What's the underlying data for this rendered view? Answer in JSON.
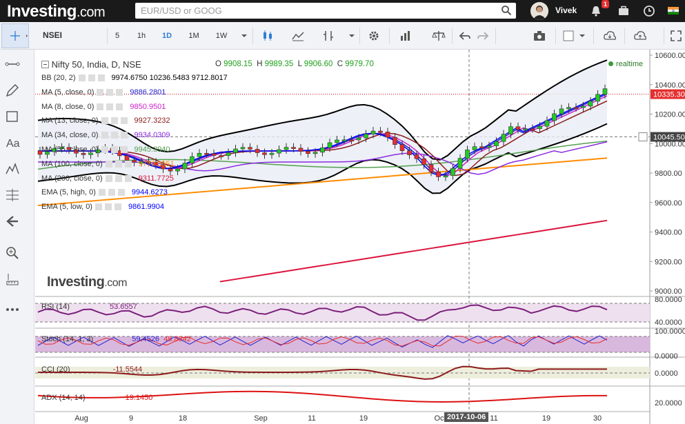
{
  "header": {
    "logo_main": "Investing",
    "logo_suffix": ".com",
    "search_placeholder": "EUR/USD or GOOG",
    "user_name": "Vivek",
    "notification_count": "1"
  },
  "toolbar": {
    "symbol": "NSEI",
    "intervals": [
      "5",
      "1h",
      "1D",
      "1M",
      "1W"
    ],
    "active_interval": "1D"
  },
  "chart": {
    "title": "Nifty 50, India, D, NSE",
    "ohlc": {
      "o_label": "O",
      "o": "9908.15",
      "h_label": "H",
      "h": "9989.35",
      "l_label": "L",
      "l": "9906.60",
      "c_label": "C",
      "c": "9979.70"
    },
    "realtime_label": "realtime",
    "indicators": [
      {
        "label": "BB (20, 2)",
        "value": "9974.6750  10236.5483  9712.8017",
        "color": "#000000"
      },
      {
        "label": "MA (5, close, 0)",
        "value": "9886.2801",
        "color": "#2222cc"
      },
      {
        "label": "MA (8, close, 0)",
        "value": "9850.9501",
        "color": "#cc22cc"
      },
      {
        "label": "MA (13, close, 0)",
        "value": "9927.3232",
        "color": "#8b1a1a"
      },
      {
        "label": "MA (34, close, 0)",
        "value": "9934.0309",
        "color": "#8a2be2"
      },
      {
        "label": "MA (55, close, 0)",
        "value": "9945.3940",
        "color": "#55a050"
      },
      {
        "label": "MA (100, close, 0)",
        "value": "9770.0951",
        "color": "#ff8c00"
      },
      {
        "label": "MA (200, close, 0)",
        "value": "9311.7725",
        "color": "#dc143c"
      },
      {
        "label": "EMA (5, high, 0)",
        "value": "9944.6273",
        "color": "#0000ff"
      },
      {
        "label": "EMA (5, low, 0)",
        "value": "9861.9904",
        "color": "#0000ff"
      }
    ],
    "price_axis": [
      "10600.00",
      "10400.00",
      "10200.00",
      "10000.00",
      "9800.00",
      "9600.00",
      "9400.00",
      "9200.00",
      "9000.00"
    ],
    "current_price": "10335.30",
    "crosshair_price": "10045.50",
    "rsi": {
      "label": "RSI (14)",
      "value": "53.6557",
      "levels": [
        "80.0000",
        "40.0000"
      ]
    },
    "stoch": {
      "label": "Stoch (14, 1, 3)",
      "k": "59.4526",
      "d": "48.8842",
      "levels": [
        "100.0000",
        "0.0000"
      ]
    },
    "cci": {
      "label": "CCI (20)",
      "value": "-11.5544",
      "levels": [
        "0.0000"
      ]
    },
    "adx": {
      "label": "ADX (14, 14)",
      "value": "19.1450",
      "levels": [
        "20.0000"
      ]
    },
    "date_axis": [
      "Aug",
      "9",
      "18",
      "Sep",
      "11",
      "19",
      "Oct",
      "11",
      "19",
      "30"
    ],
    "crosshair_date": "2017-10-06",
    "watermark": "Investing",
    "watermark_suffix": ".com",
    "colors": {
      "up": "#22cc22",
      "down": "#e52e2e",
      "bb": "#000000",
      "ma100": "#ff8c00",
      "ma200": "#dc143c"
    }
  }
}
